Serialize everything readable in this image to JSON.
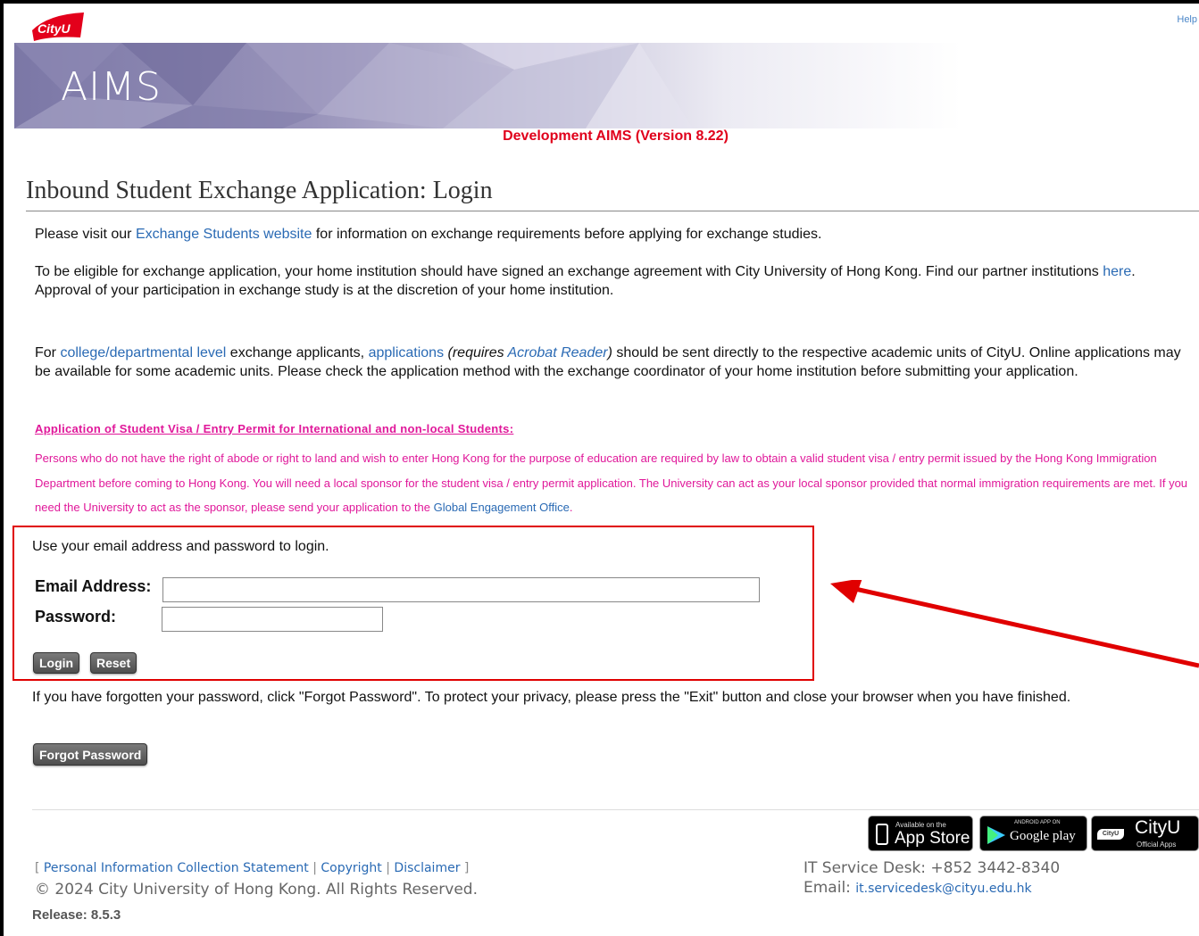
{
  "header": {
    "logo_text": "CityU",
    "help_link": "Help",
    "banner_title": "AIMS",
    "dev_version": "Development AIMS (Version 8.22)"
  },
  "page": {
    "title": "Inbound Student Exchange Application: Login"
  },
  "intro": {
    "p1_pre": "Please visit our ",
    "p1_link": "Exchange Students website",
    "p1_post": " for information on exchange requirements before applying for exchange studies.",
    "p2_pre": "To be eligible for exchange application, your home institution should have signed an exchange agreement with City University of Hong Kong. Find our partner institutions ",
    "p2_link": "here",
    "p2_post": ". Approval of your participation in exchange study is at the discretion of your home institution.",
    "p3_pre": "For ",
    "p3_link1": "college/departmental level",
    "p3_mid1": " exchange applicants, ",
    "p3_link2": "applications",
    "p3_ital_pre": " (requires ",
    "p3_link3": "Acrobat Reader",
    "p3_ital_post": ")",
    "p3_post": " should be sent directly to the respective academic units of CityU. Online applications may be available for some academic units. Please check the application method with the exchange coordinator of your home institution before submitting your application."
  },
  "visa": {
    "title": "Application of Student Visa / Entry Permit for International and non-local Students:",
    "body": "Persons who do not have the right of abode or right to land and wish to enter Hong Kong for the purpose of education are required by law to obtain a valid student visa / entry permit issued by the Hong Kong Immigration Department before coming to Hong Kong. You will need a local sponsor for the student visa / entry permit application. The University can act as your local sponsor provided that normal immigration requirements are met. If you need the University to act as the sponsor, please send your application to the ",
    "link": "Global Engagement Office",
    "end": "."
  },
  "login": {
    "intro": "Use your email address and password to login.",
    "email_label": "Email Address:",
    "email_value": "",
    "password_label": "Password:",
    "password_value": "",
    "login_button": "Login",
    "reset_button": "Reset"
  },
  "forgot": {
    "text": "If you have forgotten your password, click \"Forgot Password\". To protect your privacy, please press the \"Exit\" button and close your browser when you have finished.",
    "button": "Forgot Password"
  },
  "footer": {
    "bracket_open": "[ ",
    "link1": "Personal Information Collection Statement",
    "sep": " | ",
    "link2": "Copyright",
    "link3": "Disclaimer",
    "bracket_close": " ]",
    "copyright": "© 2024 City University of Hong Kong. All Rights Reserved.",
    "release": "Release: 8.5.3",
    "service_desk": "IT Service Desk: +852 3442-8340",
    "email_label": "Email: ",
    "email_link": "it.servicedesk@cityu.edu.hk",
    "badges": {
      "appstore_small": "Available on the",
      "appstore_big": "App Store",
      "google_small": "ANDROID APP ON",
      "google_big": "Google play",
      "cityu_small_icon": "CityU",
      "cityu_big": "CityU",
      "cityu_small": "Official Apps"
    }
  },
  "colors": {
    "accent_red": "#e0001b",
    "link_blue": "#2a6ab4",
    "visa_pink": "#e0189a"
  }
}
